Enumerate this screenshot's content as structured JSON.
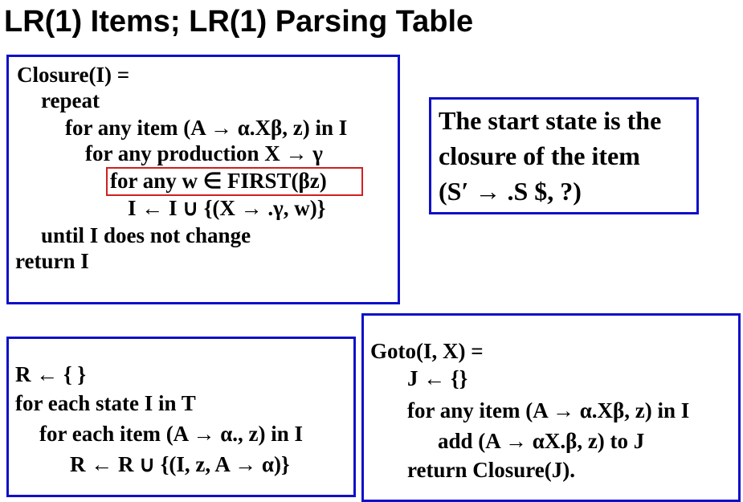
{
  "title": "LR(1) Items; LR(1) Parsing Table",
  "closure_box": {
    "lines": [
      "Closure(I) =",
      "repeat",
      "for any item (A → α.Xβ, z) in I",
      "for any production X → γ",
      "for any w ∈ FIRST(βz)",
      "I ← I ∪ {(X → .γ, w)}",
      "until I does not change",
      "return I"
    ]
  },
  "start_box": {
    "lines": [
      "The start state is the",
      "closure of the item",
      "(S′ → .S $, ?)"
    ]
  },
  "reduce_box": {
    "lines": [
      "R ← { }",
      "for each state I in T",
      "for each item (A → α., z) in I",
      "R ← R ∪ {(I, z, A → α)}"
    ]
  },
  "goto_box": {
    "lines": [
      "Goto(I, X) =",
      "J ← {}",
      "for any item (A → α.Xβ, z) in I",
      "add (A → αX.β, z) to J",
      "return Closure(J)."
    ]
  },
  "colors": {
    "box_border": "#1010c8",
    "highlight_border": "#d02020"
  }
}
